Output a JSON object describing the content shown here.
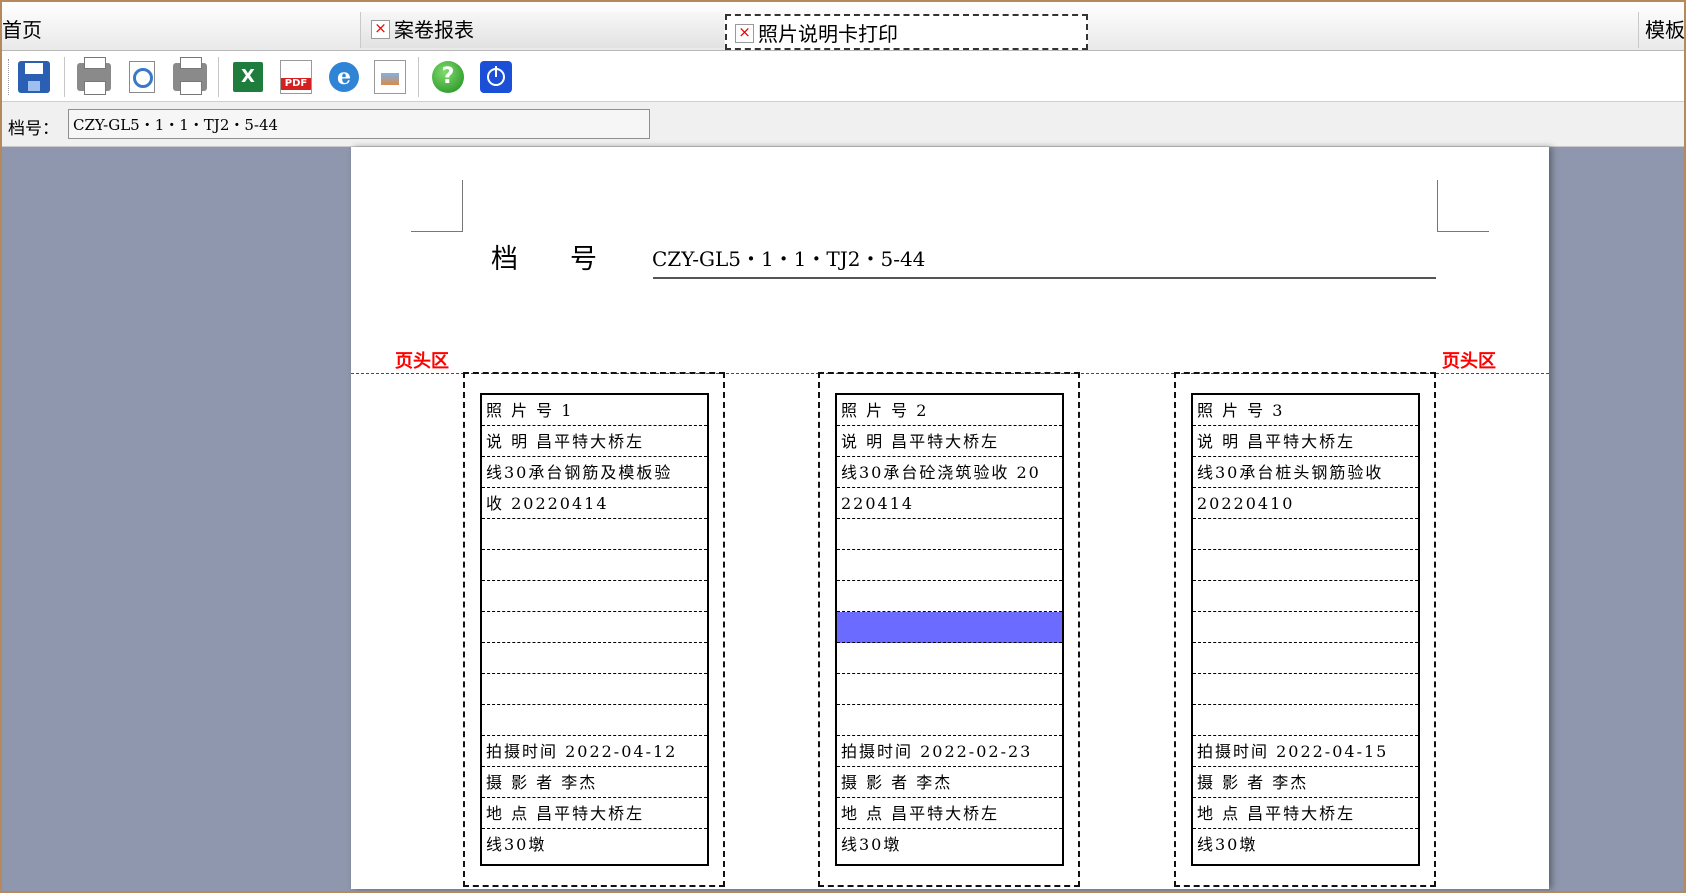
{
  "tabs": {
    "home": "首页",
    "report": "案卷报表",
    "photo_print": "照片说明卡打印",
    "template": "模板("
  },
  "numbar": {
    "label": "档号：",
    "value": "CZY-GL5・1・1・TJ2・5-44"
  },
  "document": {
    "archive_label": "档号",
    "archive_value": "CZY-GL5・1・1・TJ2・5-44",
    "header_region": "页头区"
  },
  "cards": [
    {
      "rows": [
        "照 片 号 1",
        "说      明 昌平特大桥左",
        "线30承台钢筋及模板验",
        "收 20220414",
        "",
        "",
        "",
        "",
        "",
        "",
        "",
        "拍摄时间 2022-04-12",
        "摄 影 者 李杰",
        "地      点 昌平特大桥左",
        "线30墩"
      ]
    },
    {
      "rows": [
        "照 片 号 2",
        "说      明 昌平特大桥左",
        "线30承台砼浇筑验收 20",
        "220414",
        "",
        "",
        "",
        "",
        "",
        "",
        "",
        "拍摄时间 2022-02-23",
        "摄 影 者 李杰",
        "地      点 昌平特大桥左",
        "线30墩"
      ]
    },
    {
      "rows": [
        "照 片 号 3",
        "说      明 昌平特大桥左",
        "线30承台桩头钢筋验收",
        "20220410",
        "",
        "",
        "",
        "",
        "",
        "",
        "",
        "拍摄时间 2022-04-15",
        "摄 影 者 李杰",
        "地      点 昌平特大桥左",
        "线30墩"
      ]
    }
  ],
  "colors": {
    "workspace_bg": "#8e97ad",
    "highlight_row": "#6b6bff",
    "header_line": "#ff0000"
  },
  "icons": [
    "save-icon",
    "print-icon",
    "print-preview-icon",
    "printer-setup-icon",
    "excel-export-icon",
    "pdf-export-icon",
    "ie-icon",
    "image-export-icon",
    "help-icon",
    "exit-icon"
  ]
}
